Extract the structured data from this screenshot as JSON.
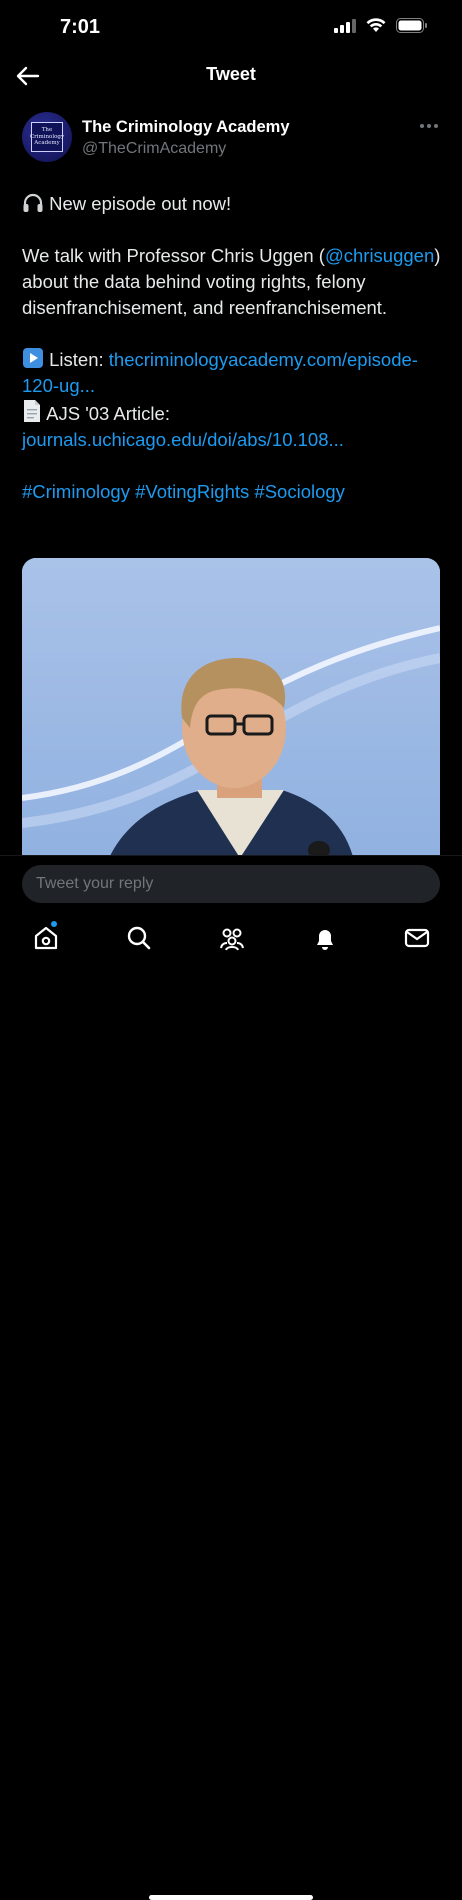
{
  "status_bar": {
    "time": "7:01"
  },
  "header": {
    "title": "Tweet"
  },
  "tweet": {
    "display_name": "The Criminology Academy",
    "handle": "@TheCrimAcademy",
    "avatar_text": [
      "The",
      "Criminology",
      "Academy"
    ],
    "line1": "New episode out now!",
    "para1_a": "We talk with Professor Chris Uggen (",
    "mention": "@chrisuggen",
    "para1_b": ") about the data behind voting rights, felony disenfranchisement, and reenfranchisement.",
    "listen_label": "Listen:",
    "listen_link": "thecriminologyacademy.com/episode-120-ug...",
    "article_label": "AJS '03 Article:",
    "article_link": "journals.uchicago.edu/doi/abs/10.108...",
    "hashtags": [
      "#Criminology",
      "#VotingRights",
      "#Sociology"
    ]
  },
  "reply": {
    "placeholder": "Tweet your reply"
  },
  "tabs": [
    "home-icon",
    "search-icon",
    "communities-icon",
    "notifications-icon",
    "messages-icon"
  ],
  "colors": {
    "link": "#1d9bf0",
    "background": "#000000",
    "secondary_text": "#71767b"
  }
}
